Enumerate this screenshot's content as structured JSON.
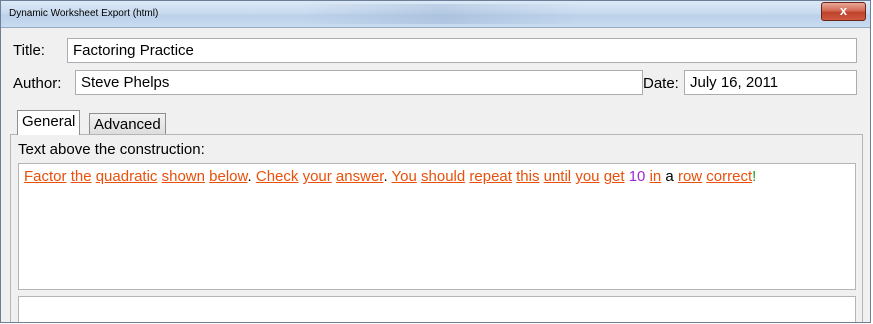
{
  "window": {
    "title": "Dynamic Worksheet Export (html)",
    "close_glyph": "x"
  },
  "form": {
    "title_label": "Title:",
    "title_value": "Factoring Practice",
    "author_label": "Author:",
    "author_value": "Steve Phelps",
    "date_label": "Date:",
    "date_value": "July 16, 2011"
  },
  "tabs": [
    {
      "label": "General",
      "active": true
    },
    {
      "label": "Advanced",
      "active": false
    }
  ],
  "general": {
    "text_above_label": "Text above the construction:",
    "text_above_tokens": [
      {
        "t": "Factor",
        "s": "w"
      },
      {
        "t": " ",
        "s": "p"
      },
      {
        "t": "the",
        "s": "w"
      },
      {
        "t": " ",
        "s": "p"
      },
      {
        "t": "quadratic",
        "s": "w"
      },
      {
        "t": " ",
        "s": "p"
      },
      {
        "t": "shown",
        "s": "w"
      },
      {
        "t": " ",
        "s": "p"
      },
      {
        "t": "below",
        "s": "w"
      },
      {
        "t": ". ",
        "s": "p"
      },
      {
        "t": "Check",
        "s": "w"
      },
      {
        "t": " ",
        "s": "p"
      },
      {
        "t": "your",
        "s": "w"
      },
      {
        "t": " ",
        "s": "p"
      },
      {
        "t": "answer",
        "s": "w"
      },
      {
        "t": ". ",
        "s": "p"
      },
      {
        "t": "You",
        "s": "w"
      },
      {
        "t": " ",
        "s": "p"
      },
      {
        "t": "should",
        "s": "w"
      },
      {
        "t": " ",
        "s": "p"
      },
      {
        "t": "repeat",
        "s": "w"
      },
      {
        "t": " ",
        "s": "p"
      },
      {
        "t": "this",
        "s": "w"
      },
      {
        "t": " ",
        "s": "p"
      },
      {
        "t": "until",
        "s": "w"
      },
      {
        "t": " ",
        "s": "p"
      },
      {
        "t": "you",
        "s": "w"
      },
      {
        "t": " ",
        "s": "p"
      },
      {
        "t": "get",
        "s": "w"
      },
      {
        "t": " ",
        "s": "p"
      },
      {
        "t": "10",
        "s": "n"
      },
      {
        "t": " ",
        "s": "p"
      },
      {
        "t": "in",
        "s": "w"
      },
      {
        "t": " a ",
        "s": "p"
      },
      {
        "t": "row",
        "s": "w"
      },
      {
        "t": " ",
        "s": "p"
      },
      {
        "t": "correct",
        "s": "w"
      },
      {
        "t": "!",
        "s": "g"
      }
    ],
    "text_below_value": ""
  },
  "colors": {
    "misspelled_word": "#e8500c",
    "number": "#9d2ad6",
    "punctuation_exclaim": "#1c9c1c",
    "close_button": "#c0432c"
  }
}
